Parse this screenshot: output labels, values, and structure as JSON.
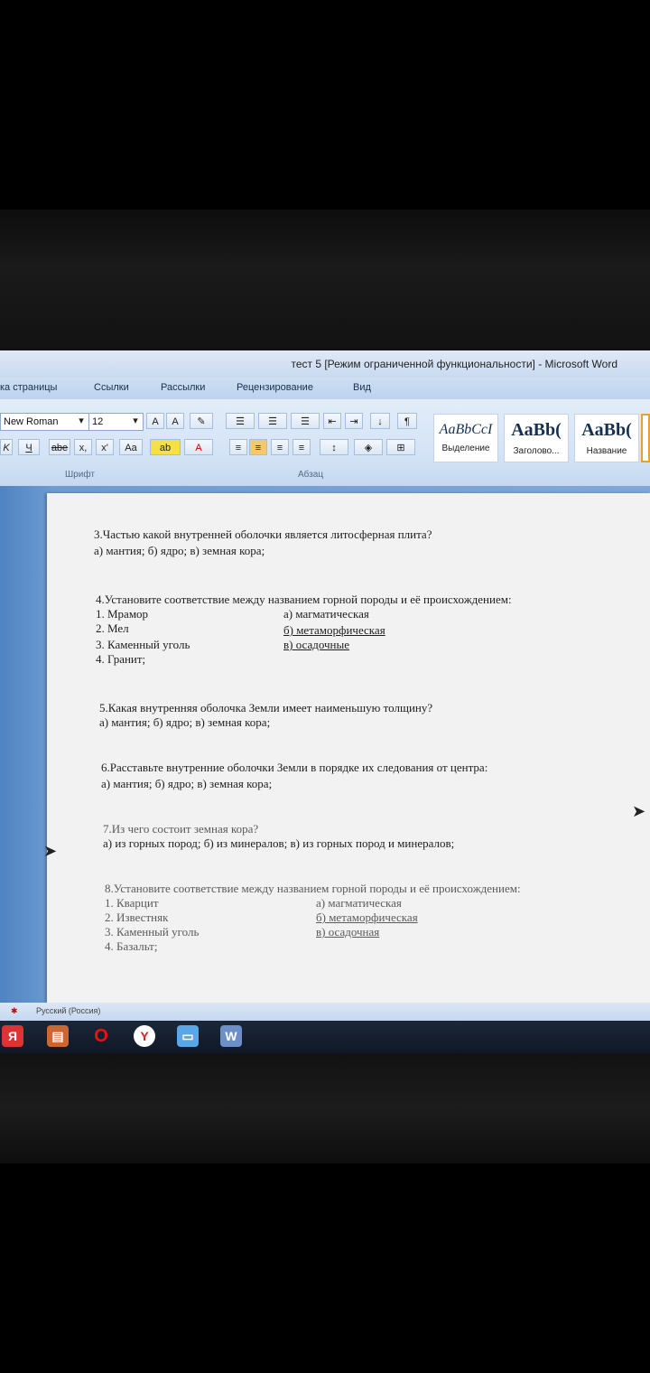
{
  "window": {
    "title": "тест 5 [Режим ограниченной функциональности] - Microsoft Word"
  },
  "ribbon_tabs": [
    "ка страницы",
    "Ссылки",
    "Рассылки",
    "Рецензирование",
    "Вид"
  ],
  "ribbon": {
    "font_name": "New Roman",
    "font_size": "12",
    "font_group_label": "Шрифт",
    "paragraph_group_label": "Абзац",
    "styles": [
      {
        "sample": "AaBbCcI",
        "name": "Выделение"
      },
      {
        "sample": "AaBb(",
        "name": "Заголово..."
      },
      {
        "sample": "AaBb(",
        "name": "Название"
      }
    ]
  },
  "document": {
    "q3": {
      "question": "3.Частью какой внутренней оболочки является литосферная плита?",
      "options": "а) мантия;    б) ядро;   в) земная кора;"
    },
    "q4": {
      "question": "4.Установите соответствие между названием горной породы и её происхождением:",
      "left": [
        "1. Мрамор",
        "2. Мел",
        "3. Каменный уголь",
        "4. Гранит;"
      ],
      "right": [
        "а) магматическая",
        "б) метаморфическая",
        "в) осадочные"
      ]
    },
    "q5": {
      "question": "5.Какая внутренняя оболочка Земли имеет наименьшую толщину?",
      "options": "а) мантия;     б) ядро;    в) земная кора;"
    },
    "q6": {
      "question": "6.Расставьте внутренние оболочки Земли в порядке их следования от центра:",
      "options": "а) мантия;     б) ядро;    в) земная кора;"
    },
    "q7": {
      "question": "7.Из чего состоит земная кора?",
      "options": "а) из горных пород;   б) из минералов;    в) из горных пород и минералов;"
    },
    "q8": {
      "question": "8.Установите соответствие между названием горной породы и её происхождением:",
      "left": [
        "1. Кварцит",
        "2. Известняк",
        "3. Каменный уголь",
        "4. Базальт;"
      ],
      "right": [
        "а) магматическая",
        "б) метаморфическая",
        "в) осадочная"
      ]
    }
  },
  "statusbar": {
    "language": "Русский (Россия)"
  },
  "colors": {
    "ribbon": "#d2e2f5",
    "doc_background": "#6d9bd2",
    "page": "#f2f2f2"
  }
}
